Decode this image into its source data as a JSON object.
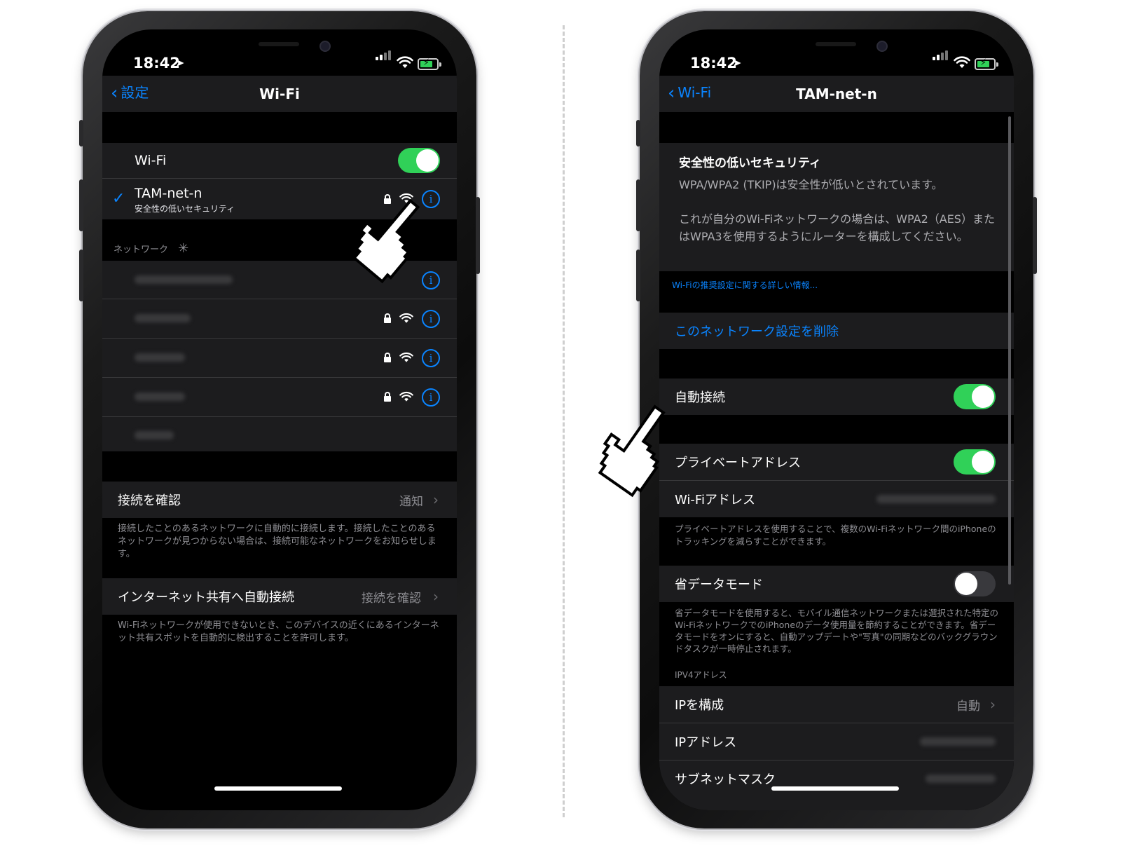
{
  "left_phone": {
    "status": {
      "time": "18:42"
    },
    "nav": {
      "back_label": "設定",
      "title": "Wi-Fi"
    },
    "wifi_toggle": {
      "label": "Wi-Fi",
      "state": "on"
    },
    "connected": {
      "name": "TAM-net-n",
      "subtitle": "安全性の低いセキュリティ"
    },
    "networks_header": "ネットワーク",
    "ask_to_join": {
      "label": "接続を確認",
      "value": "通知",
      "footer": "接続したことのあるネットワークに自動的に接続します。接続したことのあるネットワークが見つからない場合は、接続可能なネットワークをお知らせします。"
    },
    "hotspot": {
      "label": "インターネット共有へ自動接続",
      "value": "接続を確認",
      "footer": "Wi-Fiネットワークが使用できないとき、このデバイスの近くにあるインターネット共有スポットを自動的に検出することを許可します。"
    }
  },
  "right_phone": {
    "status": {
      "time": "18:42"
    },
    "nav": {
      "back_label": "Wi-Fi",
      "title": "TAM-net-n"
    },
    "warning": {
      "title": "安全性の低いセキュリティ",
      "line1": "WPA/WPA2 (TKIP)は安全性が低いとされています。",
      "line2": "これが自分のWi-Fiネットワークの場合は、WPA2（AES）またはWPA3を使用するようにルーターを構成してください。"
    },
    "learn_more": "Wi-Fiの推奨設定に関する詳しい情報...",
    "forget": "このネットワーク設定を削除",
    "auto_join": {
      "label": "自動接続",
      "state": "on"
    },
    "private_address": {
      "label": "プライベートアドレス",
      "state": "on"
    },
    "wifi_address": {
      "label": "Wi-Fiアドレス"
    },
    "private_footer": "プライベートアドレスを使用することで、複数のWi-Fiネットワーク間のiPhoneのトラッキングを減らすことができます。",
    "low_data": {
      "label": "省データモード",
      "state": "off"
    },
    "low_data_footer": "省データモードを使用すると、モバイル通信ネットワークまたは選択された特定のWi-FiネットワークでのiPhoneのデータ使用量を節約することができます。省データモードをオンにすると、自動アップデートや\"写真\"の同期などのバックグラウンドタスクが一時停止されます。",
    "ipv4_header": "IPV4アドレス",
    "configure_ip": {
      "label": "IPを構成",
      "value": "自動"
    },
    "ip_address": {
      "label": "IPアドレス"
    },
    "subnet": {
      "label": "サブネットマスク"
    }
  },
  "colors": {
    "accent": "#0a84ff",
    "toggle_on": "#30d158",
    "cell": "#1c1c1e",
    "background": "#000000"
  }
}
